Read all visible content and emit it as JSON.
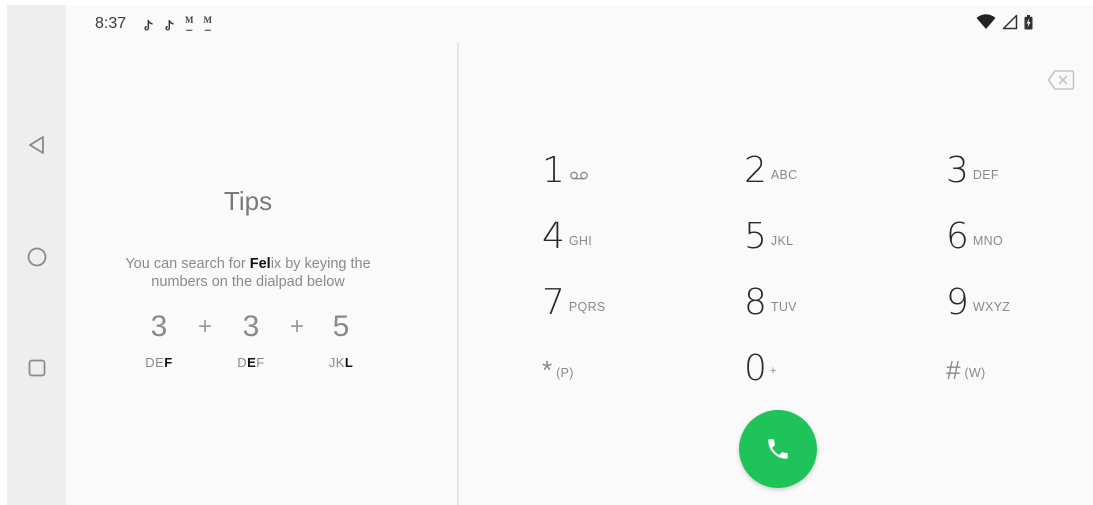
{
  "status_bar": {
    "time": "8:37",
    "notification_icons": [
      "tiktok-icon",
      "tiktok-icon",
      "gmail-icon",
      "gmail-icon"
    ],
    "system_icons": [
      "wifi-icon",
      "cellular-signal-icon",
      "battery-charging-icon"
    ]
  },
  "navigation": {
    "buttons": [
      "back",
      "home",
      "recents"
    ]
  },
  "tips": {
    "title": "Tips",
    "desc_prefix": "You can search for ",
    "desc_highlight": "Fel",
    "desc_suffix": "ix by keying the numbers on the dialpad below",
    "example": [
      {
        "digit": "3",
        "letters_plain": "DE",
        "letters_bold": "F",
        "bold_pos": "end"
      },
      {
        "digit": "3",
        "letters_plain_before": "D",
        "letters_bold": "E",
        "letters_plain_after": "F",
        "bold_pos": "middle"
      },
      {
        "digit": "5",
        "letters_plain": "JK",
        "letters_bold": "L",
        "bold_pos": "end"
      }
    ],
    "plus_sign": "+"
  },
  "dialpad": {
    "keys": [
      {
        "digit": "1",
        "letters": "",
        "icon": "voicemail-icon"
      },
      {
        "digit": "2",
        "letters": "ABC"
      },
      {
        "digit": "3",
        "letters": "DEF"
      },
      {
        "digit": "4",
        "letters": "GHI"
      },
      {
        "digit": "5",
        "letters": "JKL"
      },
      {
        "digit": "6",
        "letters": "MNO"
      },
      {
        "digit": "7",
        "letters": "PQRS"
      },
      {
        "digit": "8",
        "letters": "TUV"
      },
      {
        "digit": "9",
        "letters": "WXYZ"
      },
      {
        "digit": "*",
        "letters": "(P)"
      },
      {
        "digit": "0",
        "letters": "+"
      },
      {
        "digit": "#",
        "letters": "(W)"
      }
    ],
    "backspace_icon": "backspace-icon",
    "call_icon": "phone-icon",
    "call_color": "#1ec45a"
  }
}
